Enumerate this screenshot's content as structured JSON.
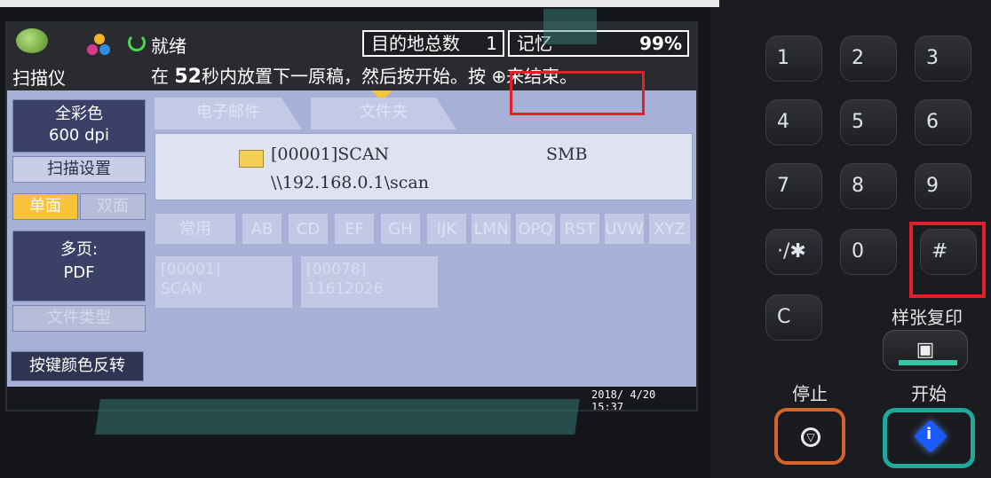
{
  "status": {
    "app_label": "扫描仪",
    "ready_label": "就绪",
    "destination_label": "目的地总数",
    "destination_count": "1",
    "memory_label": "记忆",
    "memory_percent": "99%",
    "message_prefix": "在",
    "message_seconds": "52",
    "message_main": "秒内放置下一原稿，然后按开始。",
    "message_end": "按 ⊕来结束。"
  },
  "left_panel": {
    "color_mode_line1": "全彩色",
    "color_mode_line2": "600 dpi",
    "scan_settings": "扫描设置",
    "single_side": "单面",
    "double_side": "双面",
    "multi_page_line1": "多页:",
    "multi_page_line2": "PDF",
    "file_type": "文件类型",
    "invert_key_color": "按键颜色反转"
  },
  "tabs": [
    "电子邮件",
    "文件夹"
  ],
  "destination": {
    "name": "[00001]SCAN",
    "protocol": "SMB",
    "path": "\\\\192.168.0.1\\scan"
  },
  "index_letters": [
    "常用",
    "AB",
    "CD",
    "EF",
    "GH",
    "IJK",
    "LMN",
    "OPQ",
    "RST",
    "UVW",
    "XYZ"
  ],
  "address_entries": [
    {
      "line1": "[00001]",
      "line2": "SCAN"
    },
    {
      "line1": "[00078]",
      "line2": "11612026"
    }
  ],
  "datetime": {
    "date": "2018/ 4/20",
    "time": "15:37"
  },
  "keypad": {
    "keys": [
      "1",
      "2",
      "3",
      "4",
      "5",
      "6",
      "7",
      "8",
      "9",
      "·/✱",
      "0",
      "#",
      "C"
    ],
    "sample_copy_label": "样张复印",
    "stop_label": "停止",
    "start_label": "开始"
  },
  "colors": {
    "highlight_red": "#e2202a",
    "start_teal": "#1fa89b",
    "stop_orange": "#d5632c",
    "screen_blue": "#a7b0d6"
  }
}
